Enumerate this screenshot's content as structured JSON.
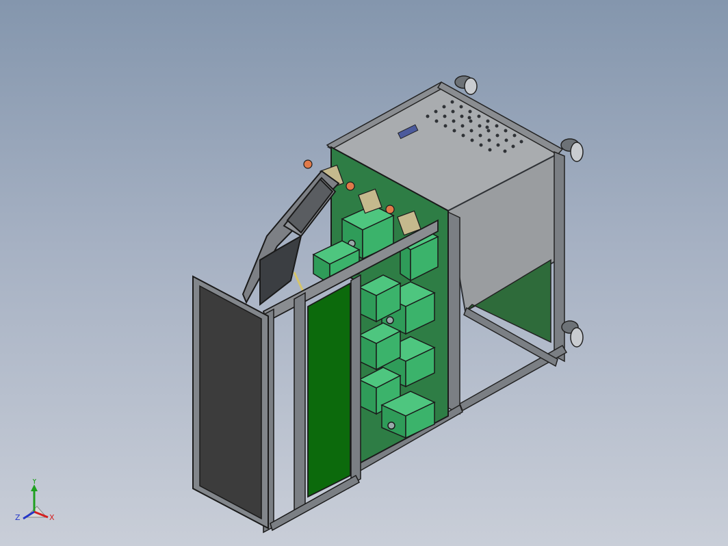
{
  "viewport": {
    "background_top": "#8496ad",
    "background_bottom": "#c9ced8"
  },
  "model": {
    "frame_color": "#7b7f84",
    "panel_green": "#2e7d45",
    "door_panel": "#3c3c3c",
    "green_strip": "#0c6a0c",
    "top_panel": "#a9acaf",
    "side_panel": "#9a9da0",
    "module_green": "#3bb36b",
    "knob_color": "#e07a4a",
    "caster_color": "#6d7277"
  },
  "triad": {
    "x_label": "X",
    "y_label": "Y",
    "z_label": "Z",
    "x_color": "#d42020",
    "y_color": "#1fa01f",
    "z_color": "#2436c8"
  }
}
